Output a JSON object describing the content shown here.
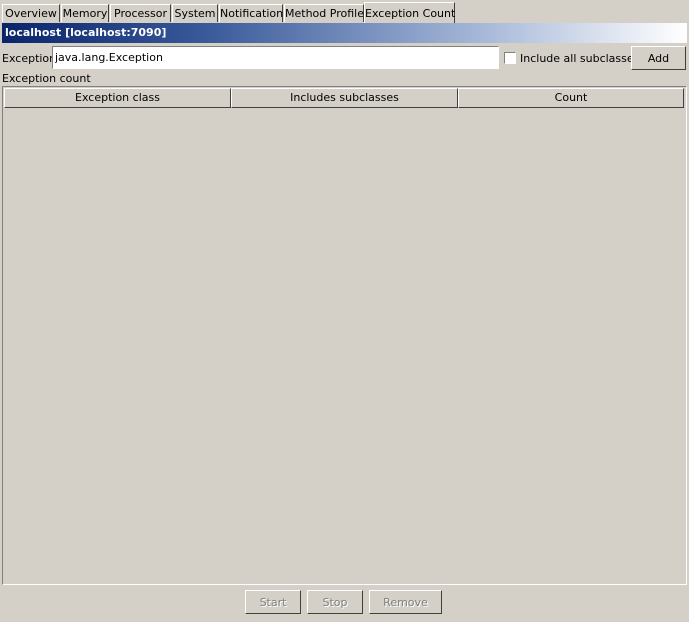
{
  "tabs": [
    {
      "label": "Overview"
    },
    {
      "label": "Memory"
    },
    {
      "label": "Processor"
    },
    {
      "label": "System"
    },
    {
      "label": "Notification"
    },
    {
      "label": "Method Profiler"
    },
    {
      "label": "Exception Count",
      "active": true
    }
  ],
  "connection": {
    "title": "localhost [localhost:7090]"
  },
  "exception_form": {
    "label": "Exception:",
    "value": "java.lang.Exception",
    "include_subclasses_label": "Include all subclasses",
    "include_subclasses_checked": false,
    "add_label": "Add"
  },
  "table": {
    "caption": "Exception count",
    "columns": [
      "Exception class",
      "Includes subclasses",
      "Count"
    ],
    "rows": []
  },
  "controls": {
    "start_label": "Start",
    "stop_label": "Stop",
    "remove_label": "Remove"
  },
  "colors": {
    "background": "#d4d0c8",
    "title_gradient_start": "#0a246a",
    "title_gradient_end": "#ffffff",
    "disabled_text": "#808080"
  }
}
